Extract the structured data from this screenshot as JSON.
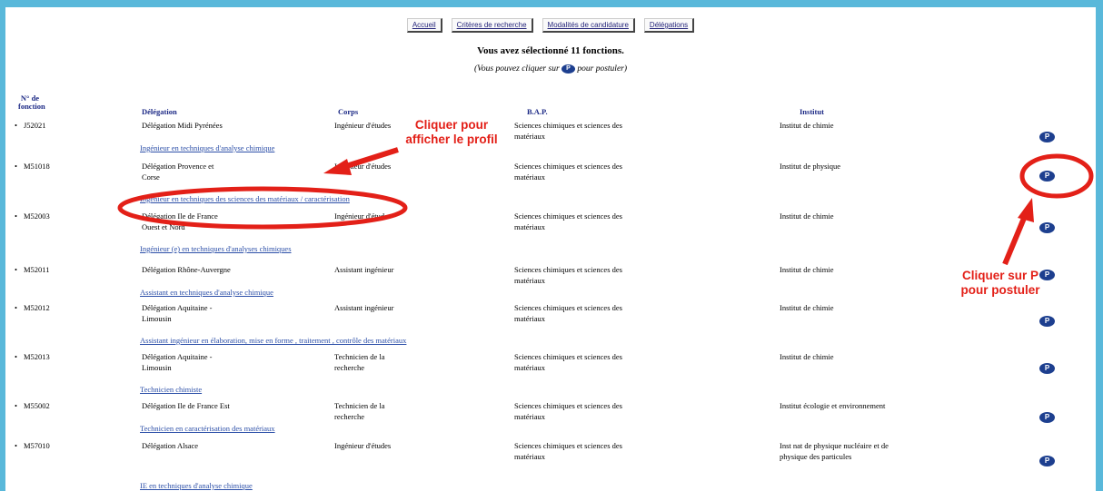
{
  "nav": [
    "Accueil",
    "Critères de recherche",
    "Modalités de candidature",
    "Délégations"
  ],
  "selected_text": "Vous avez sélectionné 11 fonctions.",
  "hint": {
    "before": "(Vous pouvez cliquer sur",
    "after": "pour postuler)",
    "icon_letter": "P"
  },
  "headers": {
    "num": "N° de fonction",
    "delegation": "Délégation",
    "corps": "Corps",
    "bap": "B.A.P.",
    "institut": "Institut"
  },
  "rows": [
    {
      "num": "J52021",
      "delegation": "Délégation Midi Pyrénées",
      "corps": "Ingénieur d'études",
      "bap": "Sciences chimiques et sciences des matériaux",
      "institut": "Institut de chimie",
      "link": "Ingénieur en techniques d'analyse chimique"
    },
    {
      "num": "M51018",
      "delegation": "Délégation Provence et Corse",
      "corps": "Ingénieur d'études",
      "bap": "Sciences chimiques et sciences des matériaux",
      "institut": "Institut de physique",
      "link": "Ingénieur en techniques des sciences des matériaux / caractérisation"
    },
    {
      "num": "M52003",
      "delegation": "Délégation Ile de France Ouest et Nord",
      "corps": "Ingénieur d'études",
      "bap": "Sciences chimiques et sciences des matériaux",
      "institut": "Institut de chimie",
      "link": "Ingénieur (e) en techniques d'analyses chimiques"
    },
    {
      "num": "M52011",
      "delegation": "Délégation Rhône-Auvergne",
      "corps": "Assistant ingénieur",
      "bap": "Sciences chimiques et sciences des matériaux",
      "institut": "Institut de chimie",
      "link": "Assistant en techniques d'analyse chimique"
    },
    {
      "num": "M52012",
      "delegation": "Délégation Aquitaine - Limousin",
      "corps": "Assistant ingénieur",
      "bap": "Sciences chimiques et sciences des matériaux",
      "institut": "Institut de chimie",
      "link": "Assistant ingénieur en élaboration, mise en forme , traitement , contrôle des matériaux"
    },
    {
      "num": "M52013",
      "delegation": "Délégation Aquitaine - Limousin",
      "corps": "Technicien de la recherche",
      "bap": "Sciences chimiques et sciences des matériaux",
      "institut": "Institut de chimie",
      "link": "Technicien chimiste"
    },
    {
      "num": "M55002",
      "delegation": "Délégation Ile de France Est",
      "corps": "Technicien de la recherche",
      "bap": "Sciences chimiques et sciences des matériaux",
      "institut": "Institut écologie et environnement",
      "link": "Technicien en caractérisation des matériaux"
    },
    {
      "num": "M57010",
      "delegation": "Délégation Alsace",
      "corps": "Ingénieur d'études",
      "bap": "Sciences chimiques et sciences des matériaux",
      "institut": "Inst nat de physique nucléaire et de physique des particules",
      "link": "IE en techniques d'analyse chimique"
    }
  ],
  "annotations": {
    "profile": "Cliquer pour afficher le profil",
    "apply": "Cliquer sur P pour postuler",
    "color": "#e32018"
  },
  "colors": {
    "header": "#1d2a86",
    "link": "#2c4fa8",
    "icon": "#1d3f8f",
    "frame": "#59b8da"
  }
}
